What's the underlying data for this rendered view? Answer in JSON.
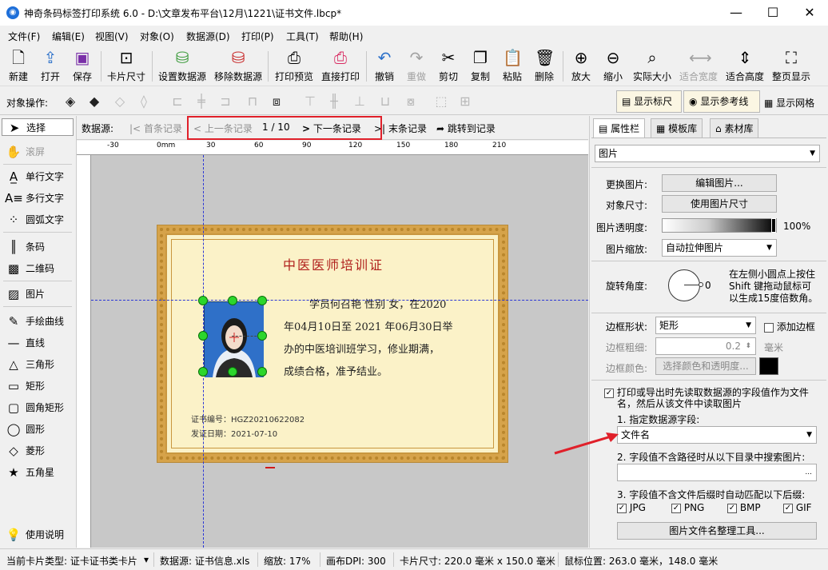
{
  "window": {
    "title": "神奇条码标签打印系统 6.0 - D:\\文章发布平台\\12月\\1221\\证书文件.lbcp*",
    "app_icon": "app-logo-icon",
    "minimize": "—",
    "maximize": "☐",
    "close": "✕"
  },
  "menu": [
    "文件(F)",
    "编辑(E)",
    "视图(V)",
    "对象(O)",
    "数据源(D)",
    "打印(P)",
    "工具(T)",
    "帮助(H)"
  ],
  "toolbar": [
    {
      "label": "新建",
      "icon": "new-file-icon"
    },
    {
      "label": "打开",
      "icon": "open-icon"
    },
    {
      "label": "保存",
      "icon": "save-icon"
    },
    {
      "label": "卡片尺寸",
      "icon": "card-size-icon"
    },
    {
      "label": "设置数据源",
      "icon": "set-datasource-icon"
    },
    {
      "label": "移除数据源",
      "icon": "remove-datasource-icon"
    },
    {
      "label": "打印预览",
      "icon": "print-preview-icon"
    },
    {
      "label": "直接打印",
      "icon": "print-icon"
    },
    {
      "label": "撤销",
      "icon": "undo-icon"
    },
    {
      "label": "重做",
      "icon": "redo-icon"
    },
    {
      "label": "剪切",
      "icon": "cut-icon"
    },
    {
      "label": "复制",
      "icon": "copy-icon"
    },
    {
      "label": "粘贴",
      "icon": "paste-icon"
    },
    {
      "label": "删除",
      "icon": "delete-icon"
    },
    {
      "label": "放大",
      "icon": "zoom-in-icon"
    },
    {
      "label": "缩小",
      "icon": "zoom-out-icon"
    },
    {
      "label": "实际大小",
      "icon": "actual-size-icon"
    },
    {
      "label": "适合宽度",
      "icon": "fit-width-icon"
    },
    {
      "label": "适合高度",
      "icon": "fit-height-icon"
    },
    {
      "label": "整页显示",
      "icon": "full-page-icon"
    }
  ],
  "objops": {
    "label": "对象操作:",
    "show_ruler": "显示标尺",
    "show_guides": "显示参考线",
    "show_grid": "显示网格"
  },
  "tools": {
    "select": "选择",
    "scroll": "滚屏",
    "single_text": "单行文字",
    "multi_text": "多行文字",
    "arc_text": "圆弧文字",
    "barcode": "条码",
    "qrcode": "二维码",
    "image": "图片",
    "freehand": "手绘曲线",
    "line": "直线",
    "triangle": "三角形",
    "rect": "矩形",
    "round_rect": "圆角矩形",
    "circle": "圆形",
    "diamond": "菱形",
    "star": "五角星",
    "help": "使用说明"
  },
  "nav": {
    "label": "数据源:",
    "first": "首条记录",
    "prev": "上一条记录",
    "pos": "1 / 10",
    "next": "下一条记录",
    "last": "末条记录",
    "goto": "跳转到记录"
  },
  "ruler": {
    "h_ticks": [
      "-30",
      "0mm",
      "30",
      "60",
      "90",
      "120",
      "150",
      "180",
      "210"
    ]
  },
  "certificate": {
    "title": "中医医师培训证",
    "line1": "学员何召艳 性别 女，在2020",
    "line2": "年04月10日至 2021 年06月30日举",
    "line3": "办的中医培训班学习，修业期满，",
    "line4": "成绩合格，准予结业。",
    "cert_no_label": "证书编号：",
    "cert_no": "HGZ20210622082",
    "date_label": "发证日期：",
    "date": "2021-07-10"
  },
  "panel": {
    "tab_props": "属性栏",
    "tab_templates": "模板库",
    "tab_assets": "素材库",
    "object_type": "图片",
    "change_image": "更换图片:",
    "edit_image": "编辑图片...",
    "object_size": "对象尺寸:",
    "use_image_size": "使用图片尺寸",
    "opacity_label": "图片透明度:",
    "opacity_value": "100%",
    "opacity_fraction": 1.0,
    "scale_label": "图片缩放:",
    "scale_value": "自动拉伸图片",
    "rotate_label": "旋转角度:",
    "rotate_value": "0",
    "rotate_hint1": "在左侧小圆点上按住",
    "rotate_hint2": "Shift 键拖动鼠标可",
    "rotate_hint3": "以生成15度倍数角。",
    "border_shape_label": "边框形状:",
    "border_shape": "矩形",
    "add_border": "添加边框",
    "border_width_label": "边框粗细:",
    "border_width": "0.2",
    "border_unit": "毫米",
    "border_color_label": "边框颜色:",
    "choose_color": "选择颜色和透明度...",
    "read_field_1": "打印或导出时先读取数据源的字段值作为文件",
    "read_field_2": "名，然后从该文件中读取图片",
    "step1": "1. 指定数据源字段:",
    "field_value": "文件名",
    "step2": "2. 字段值不含路径时从以下目录中搜索图片:",
    "dir_browse": "...",
    "step3": "3. 字段值不含文件后缀时自动匹配以下后缀:",
    "ext": [
      "JPG",
      "PNG",
      "BMP",
      "GIF"
    ],
    "tidy_tool": "图片文件名整理工具..."
  },
  "status": {
    "card_type": "当前卡片类型: 证卡证书类卡片",
    "datasource": "数据源: 证书信息.xls",
    "zoom": "缩放: 17%",
    "dpi": "画布DPI: 300",
    "card_size": "卡片尺寸: 220.0 毫米 x 150.0 毫米",
    "mouse_pos": "鼠标位置: 263.0 毫米，148.0 毫米"
  },
  "colors": {
    "accent_red": "#e0202a",
    "handle_green": "#2cd62c",
    "guide_blue": "#2b36d6",
    "cert_gold": "#d6a34a",
    "cert_title": "#b0201c"
  }
}
